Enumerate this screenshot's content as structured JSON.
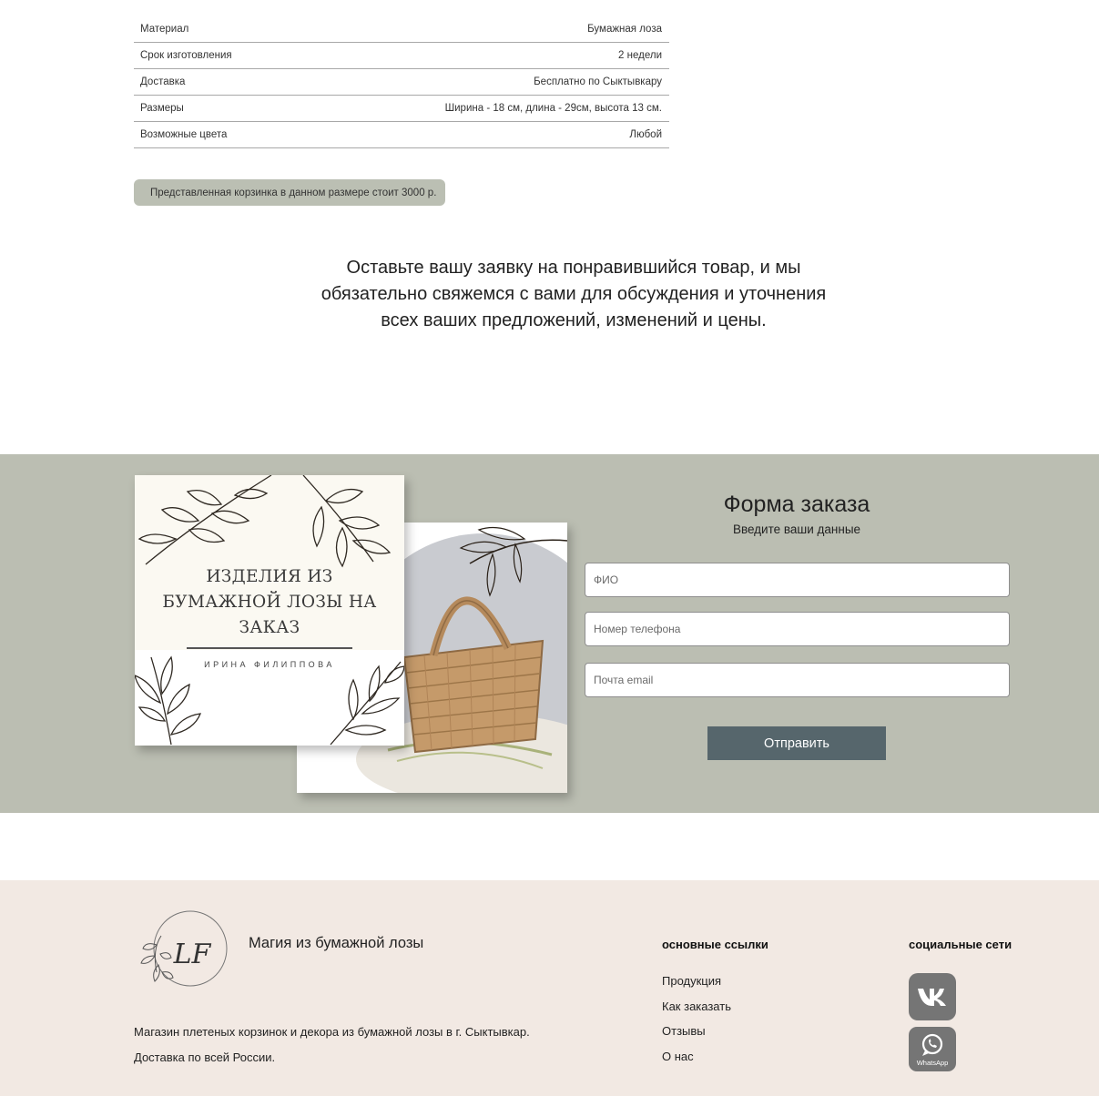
{
  "specs": [
    {
      "label": "Материал",
      "value": "Бумажная лоза"
    },
    {
      "label": "Срок изготовления",
      "value": "2 недели"
    },
    {
      "label": "Доставка",
      "value": "Бесплатно по Сыктывкару"
    },
    {
      "label": "Размеры",
      "value": "Ширина - 18 см, длина - 29см, высота 13 см."
    },
    {
      "label": "Возможные цвета",
      "value": "Любой"
    }
  ],
  "price_note": "Представленная корзинка в данном размере стоит 3000 р.",
  "lead": {
    "line1": "Оставьте вашу заявку на понравившийся товар, и мы",
    "line2": "обязательно свяжемся с вами для обсуждения и уточнения",
    "line3": "всех ваших предложений, изменений и цены."
  },
  "card": {
    "title_line1": "ИЗДЕЛИЯ ИЗ",
    "title_line2": "БУМАЖНОЙ ЛОЗЫ НА",
    "title_line3": "ЗАКАЗ",
    "author": "ИРИНА ФИЛИППОВА"
  },
  "form": {
    "title": "Форма заказа",
    "subtitle": "Введите ваши данные",
    "name_placeholder": "ФИО",
    "phone_placeholder": "Номер телефона",
    "email_placeholder": "Почта email",
    "submit_label": "Отправить"
  },
  "footer": {
    "logo_text": "LF",
    "logo_ring_text": "Магия из бумажной лозы",
    "brand": "Магия из бумажной лозы",
    "about_line1": "Магазин плетеных корзинок и декора из бумажной лозы в г. Сыктывкар.",
    "about_line2": "Доставка по всей России.",
    "links_heading": "основные ссылки",
    "links": [
      "Продукция",
      "Как заказать",
      "Отзывы",
      "О нас"
    ],
    "social_heading": "социальные сети",
    "social": [
      {
        "icon": "vk-icon",
        "label": "VK"
      },
      {
        "icon": "whatsapp-icon",
        "label": "WhatsApp"
      }
    ]
  },
  "colors": {
    "band": "#bbbeb2",
    "button": "#56666c",
    "footer_bg": "#f2e9e3",
    "social_bg": "#757575"
  }
}
